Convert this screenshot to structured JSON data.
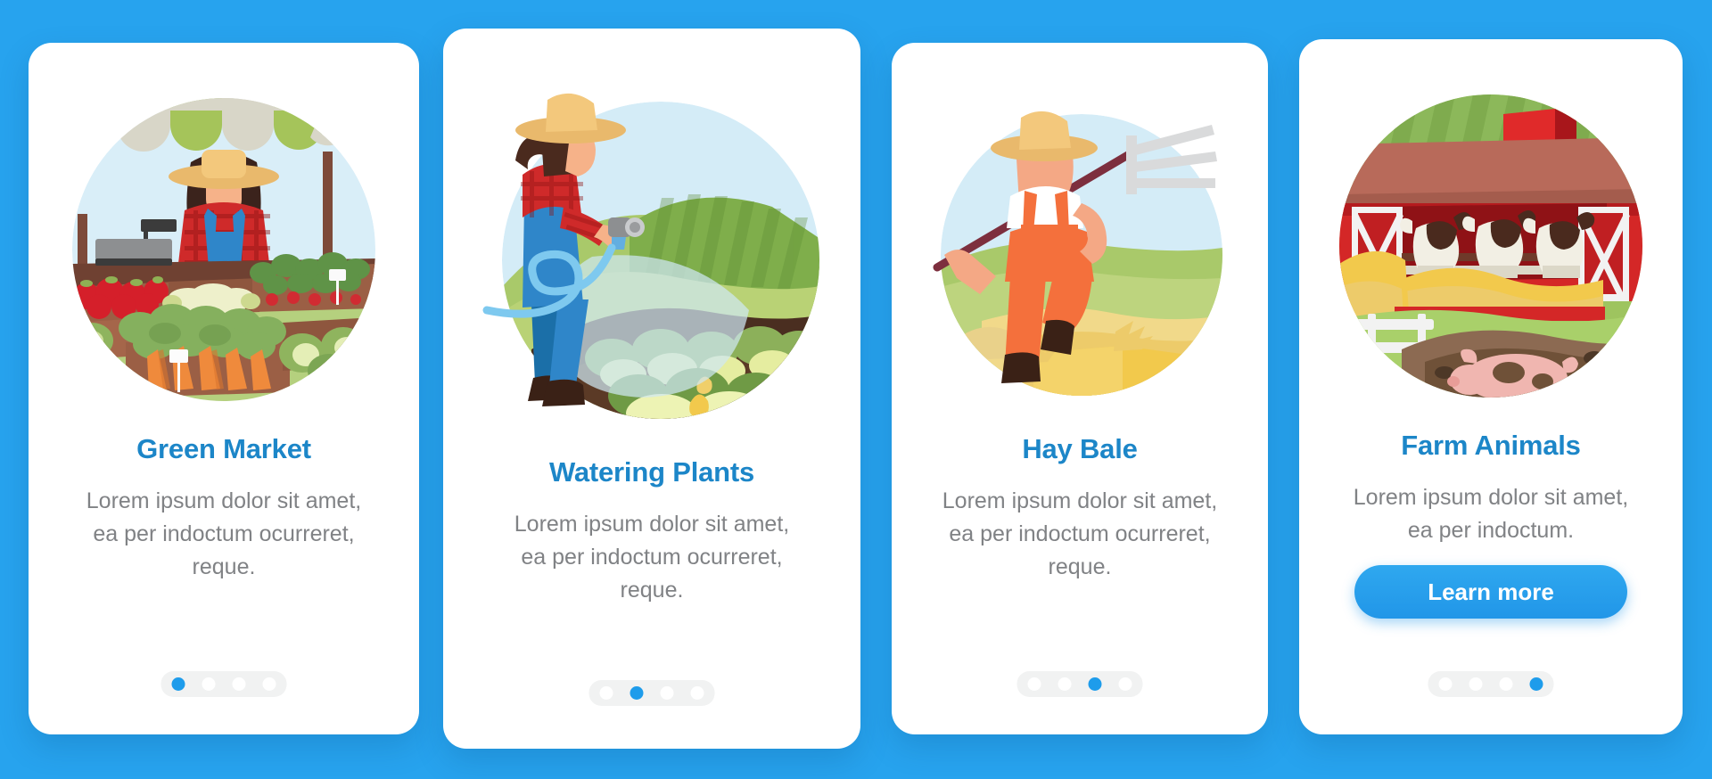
{
  "background_color": "#27a3ee",
  "accent_color": "#1c86c8",
  "button_color": "#2196e8",
  "dot_active_color": "#1e9ceb",
  "dot_inactive_color": "#ffffff",
  "cards": [
    {
      "id": "green-market",
      "title": "Green Market",
      "description": "Lorem ipsum dolor sit amet, ea per indoctum ocurreret, reque.",
      "illustration": "green-market-illustration",
      "pagination": {
        "total": 4,
        "active_index": 0
      },
      "button": null
    },
    {
      "id": "watering-plants",
      "title": "Watering Plants",
      "description": "Lorem ipsum dolor sit amet, ea per indoctum ocurreret, reque.",
      "illustration": "watering-plants-illustration",
      "pagination": {
        "total": 4,
        "active_index": 1
      },
      "button": null
    },
    {
      "id": "hay-bale",
      "title": "Hay Bale",
      "description": "Lorem ipsum dolor sit amet, ea per indoctum ocurreret, reque.",
      "illustration": "hay-bale-illustration",
      "pagination": {
        "total": 4,
        "active_index": 2
      },
      "button": null
    },
    {
      "id": "farm-animals",
      "title": "Farm Animals",
      "description": "Lorem ipsum dolor sit amet, ea per indoctum.",
      "illustration": "farm-animals-illustration",
      "pagination": {
        "total": 4,
        "active_index": 3
      },
      "button": {
        "label": "Learn more"
      }
    }
  ]
}
